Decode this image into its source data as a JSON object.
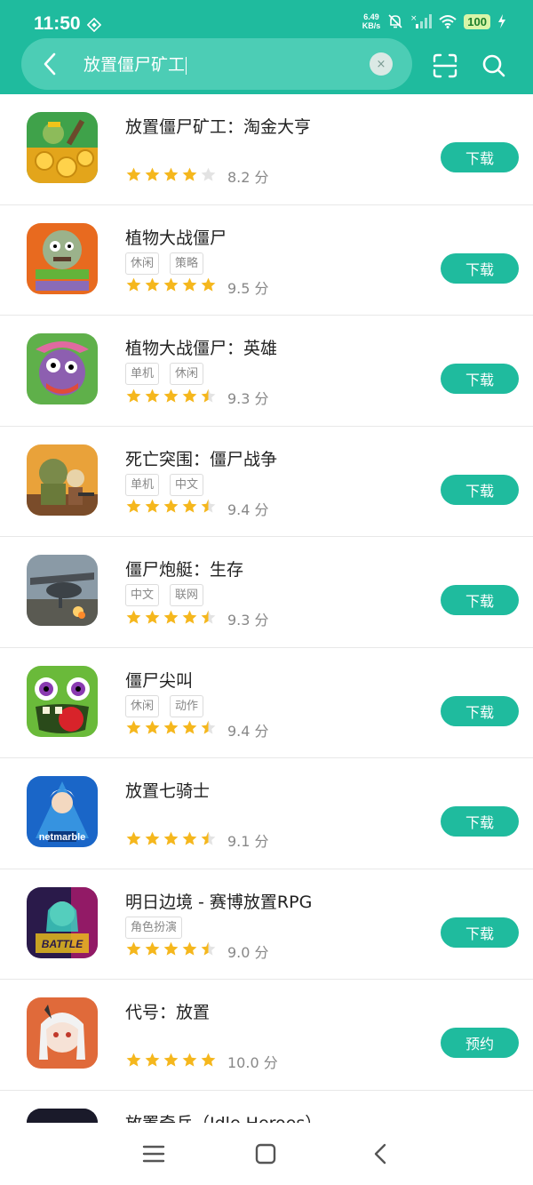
{
  "status": {
    "time": "11:50",
    "net_speed_value": "6.49",
    "net_speed_unit": "KB/s",
    "battery": "100"
  },
  "search": {
    "query": "放置僵尸矿工",
    "clear_symbol": "×"
  },
  "colors": {
    "accent": "#1fbb9e",
    "star": "#f5b71d",
    "star_empty": "#e3e3e3"
  },
  "apps": [
    {
      "title": "放置僵尸矿工：淘金大亨",
      "tags": [],
      "rating": 4,
      "score": "8.2 分",
      "button": "下载",
      "icon": "gold-coins-zombie-miner-icon"
    },
    {
      "title": "植物大战僵尸",
      "tags": [
        "休闲",
        "策略"
      ],
      "rating": 5,
      "score": "9.5 分",
      "button": "下载",
      "icon": "plants-vs-zombies-icon"
    },
    {
      "title": "植物大战僵尸：英雄",
      "tags": [
        "单机",
        "休闲"
      ],
      "rating": 4.5,
      "score": "9.3 分",
      "button": "下载",
      "icon": "pvz-heroes-icon"
    },
    {
      "title": "死亡突围：僵尸战争",
      "tags": [
        "单机",
        "中文"
      ],
      "rating": 4.5,
      "score": "9.4 分",
      "button": "下载",
      "icon": "dead-ahead-zombie-warfare-icon"
    },
    {
      "title": "僵尸炮艇：生存",
      "tags": [
        "中文",
        "联网"
      ],
      "rating": 4.5,
      "score": "9.3 分",
      "button": "下载",
      "icon": "zombie-gunship-icon"
    },
    {
      "title": "僵尸尖叫",
      "tags": [
        "休闲",
        "动作"
      ],
      "rating": 4.5,
      "score": "9.4 分",
      "button": "下载",
      "icon": "zombie-tsunami-icon"
    },
    {
      "title": "放置七骑士",
      "tags": [],
      "rating": 4.5,
      "score": "9.1 分",
      "button": "下载",
      "icon": "netmarble-knight-icon"
    },
    {
      "title": "明日边境 - 赛博放置RPG",
      "tags": [
        "角色扮演"
      ],
      "rating": 4.5,
      "score": "9.0 分",
      "button": "下载",
      "icon": "battle-night-cyber-girl-icon"
    },
    {
      "title": "代号：放置",
      "tags": [],
      "rating": 5,
      "score": "10.0 分",
      "button": "预约",
      "icon": "anime-girl-icon"
    },
    {
      "title": "放置奇兵（Idle Heroes）",
      "tags": [],
      "rating": 0,
      "score": "",
      "button": "",
      "icon": "idle-heroes-icon"
    }
  ]
}
